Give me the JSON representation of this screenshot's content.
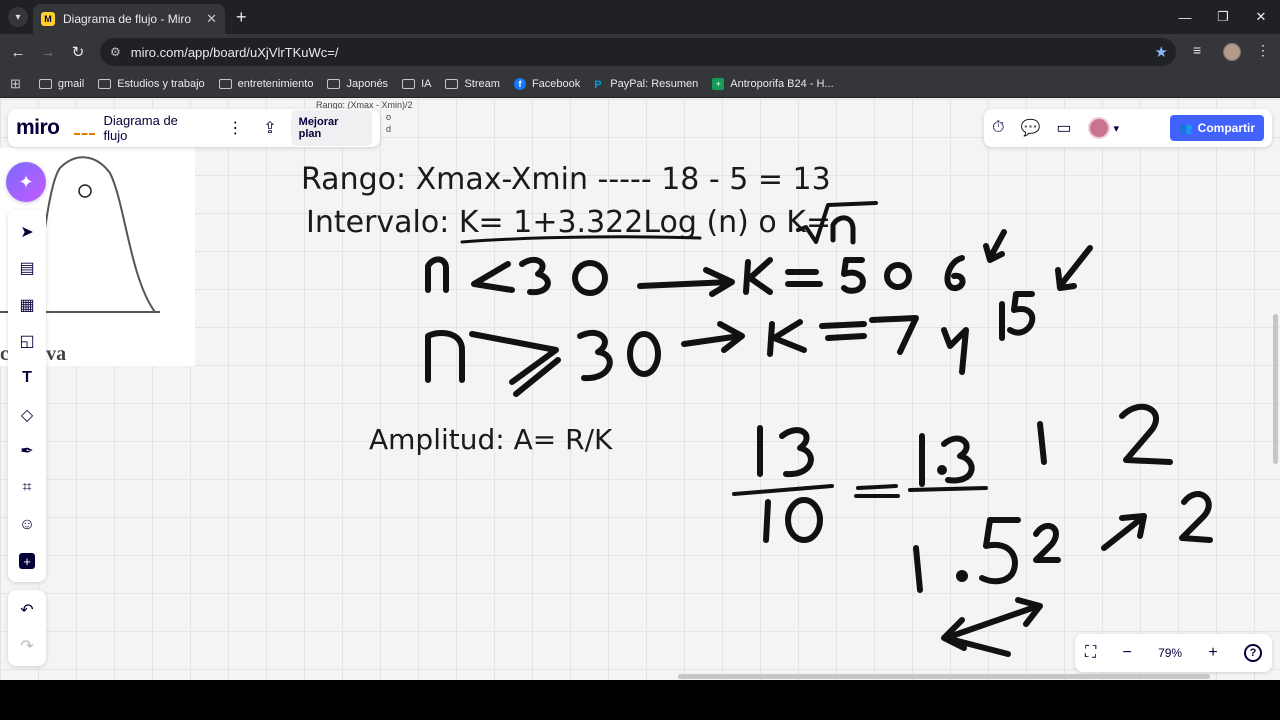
{
  "browser": {
    "tab_title": "Diagrama de flujo - Miro",
    "tab_favicon": "M",
    "url": "miro.com/app/board/uXjVlrTKuWc=/",
    "bookmarks": [
      {
        "label": "gmail",
        "icon": "folder-icon"
      },
      {
        "label": "Estudios y trabajo",
        "icon": "folder-icon"
      },
      {
        "label": "entretenimiento",
        "icon": "folder-icon"
      },
      {
        "label": "Japonés",
        "icon": "folder-icon"
      },
      {
        "label": "IA",
        "icon": "folder-icon"
      },
      {
        "label": "Stream",
        "icon": "folder-icon"
      },
      {
        "label": "Facebook",
        "icon": "facebook-icon"
      },
      {
        "label": "PayPal: Resumen",
        "icon": "paypal-icon"
      },
      {
        "label": "Antroporifa B24 - H...",
        "icon": "sheets-icon"
      }
    ]
  },
  "miro": {
    "logo": "miro",
    "board_name": "Diagrama de flujo",
    "upgrade_label": "Mejorar plan",
    "share_label": "Compartir",
    "zoom": "79%",
    "accent": "#4262ff"
  },
  "board": {
    "tiny_note": [
      "Rango: (Xmax - Xmin)/2",
      "o",
      "d"
    ],
    "image_caption": "c gativa",
    "rango": "Rango: Xmax-Xmin  ----- 18 - 5 = 13",
    "intervalo": "Intervalo: K= 1+3.322Log (n) o K=",
    "amplitud": "Amplitud:  A= R/K"
  }
}
